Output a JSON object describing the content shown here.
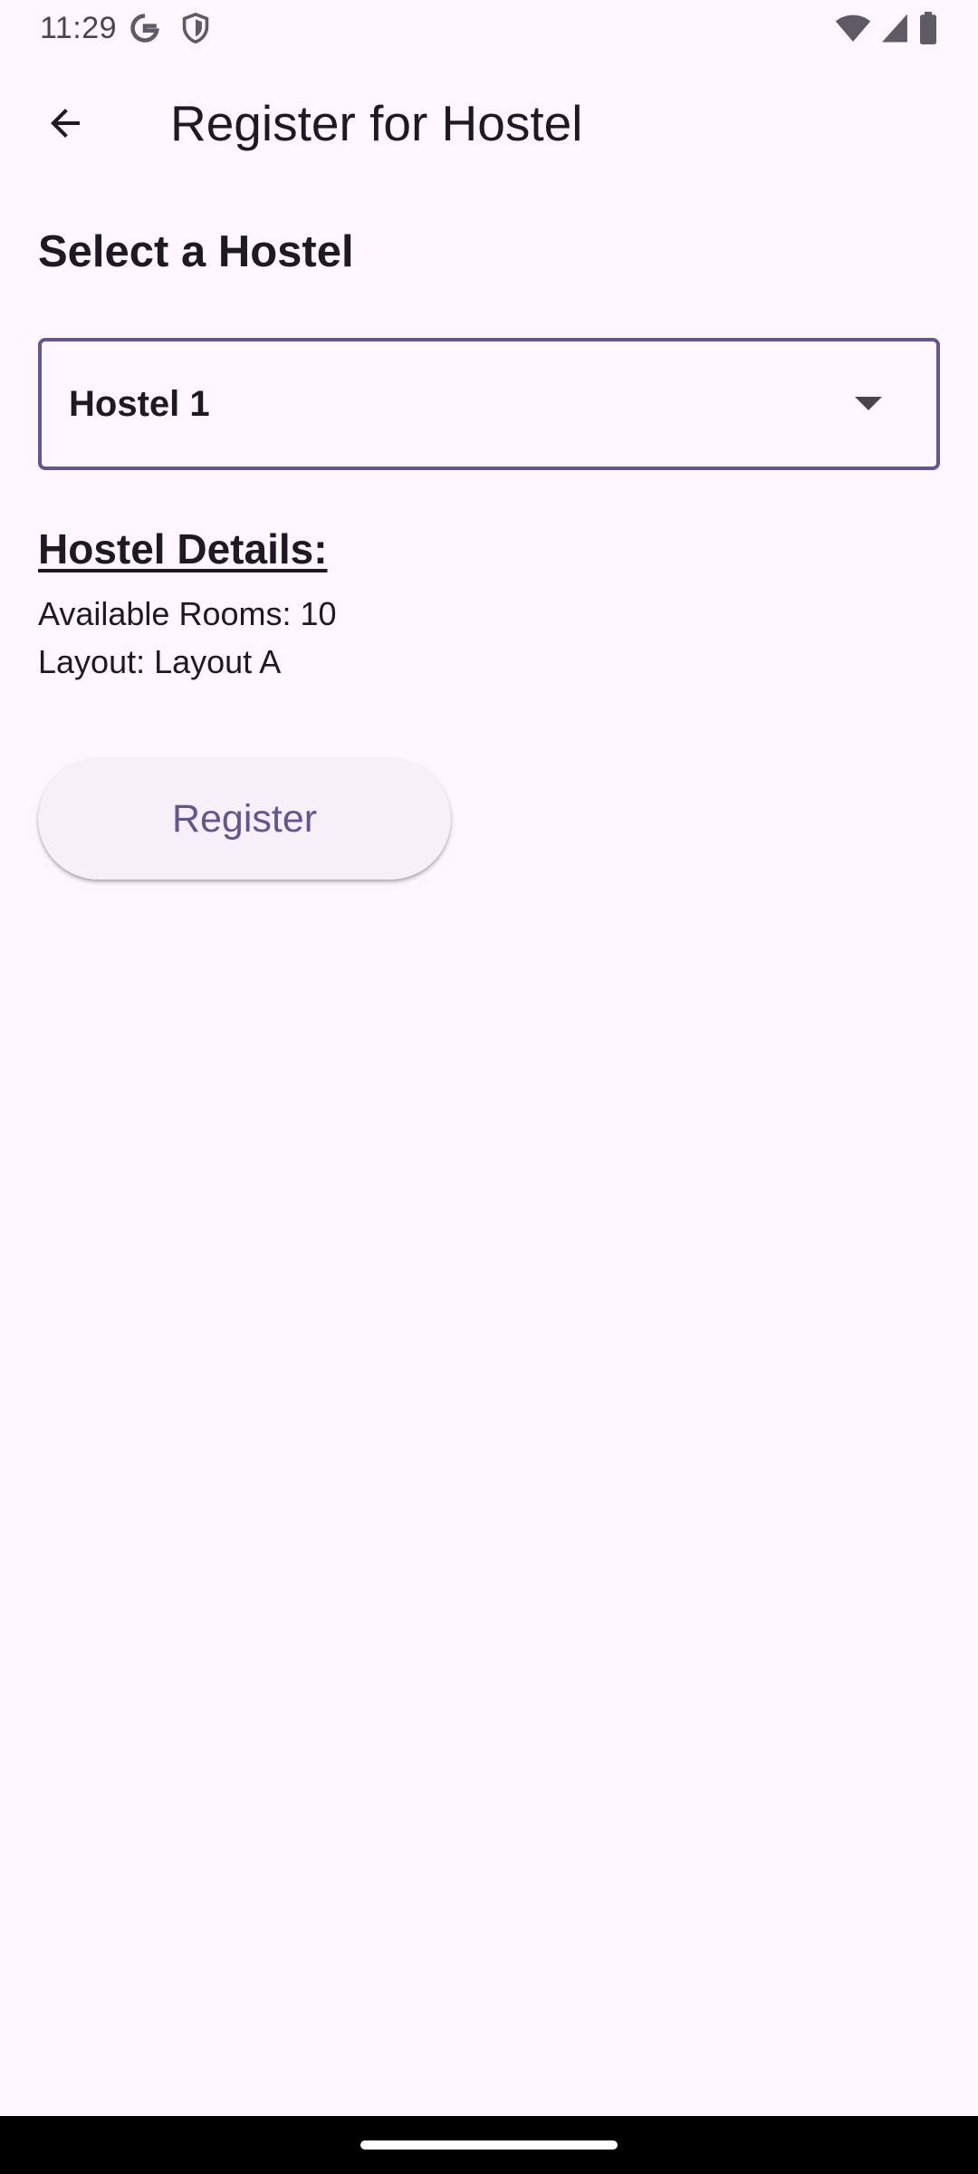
{
  "status_bar": {
    "time": "11:29",
    "icons": [
      "google-icon",
      "shield-icon",
      "wifi-icon",
      "cellular-signal-icon",
      "battery-icon"
    ]
  },
  "app_bar": {
    "title": "Register for Hostel",
    "back_icon": "arrow-back-icon"
  },
  "main": {
    "section_title": "Select a Hostel",
    "dropdown": {
      "selected_value": "Hostel 1",
      "arrow_icon": "dropdown-arrow-icon"
    },
    "details_title": "Hostel Details:",
    "available_rooms": "Available Rooms: 10",
    "layout": "Layout: Layout A",
    "register_label": "Register"
  },
  "colors": {
    "background": "#fdf7fd",
    "accent": "#65558f",
    "text": "#1d1b20",
    "button_bg": "#f6f1f8"
  }
}
